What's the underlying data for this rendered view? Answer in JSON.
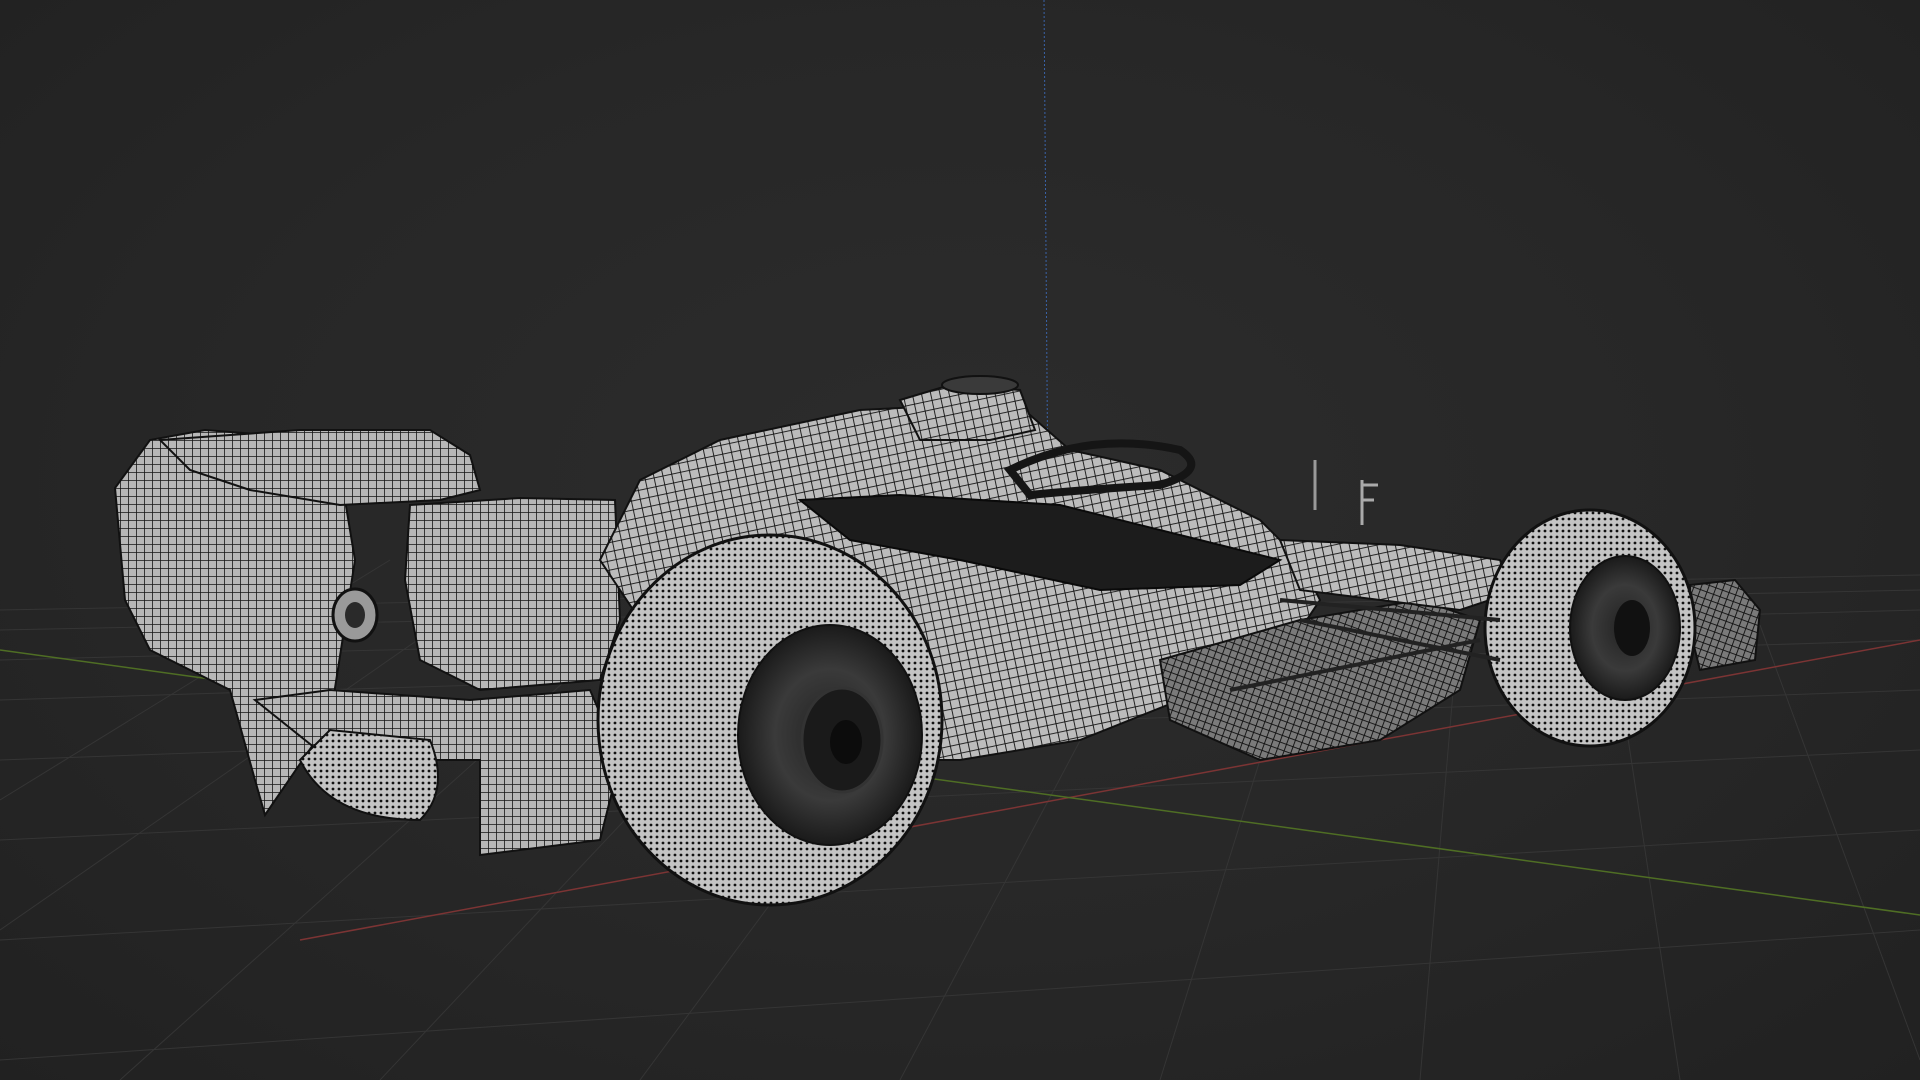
{
  "viewport": {
    "background_color": "#262626",
    "grid_line_color": "#3a3a3a",
    "x_axis_color": "#8a3a3a",
    "y_axis_color": "#5c7a2c",
    "z_axis_color": "#3a63a8",
    "mesh_face_color": "#bdbdbd",
    "mesh_wire_color": "#111111",
    "shading_mode": "wireframe-overlay",
    "object": {
      "name_icon": "formula-car-mesh"
    }
  }
}
